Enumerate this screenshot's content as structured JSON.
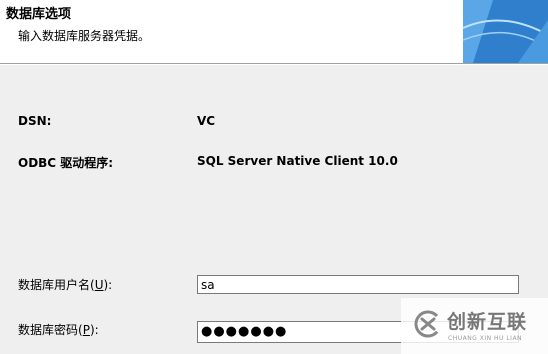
{
  "header": {
    "title": "数据库选项",
    "subtitle": "输入数据库服务器凭据。"
  },
  "details": {
    "dsn_label": "DSN:",
    "dsn_value": "VC",
    "driver_label": "ODBC 驱动程序:",
    "driver_value": "SQL Server Native Client 10.0"
  },
  "credentials": {
    "username_label_pre": "数据库用户名(",
    "username_hotkey": "U",
    "username_label_post": "):",
    "username_value": "sa",
    "password_label_pre": "数据库密码(",
    "password_hotkey": "P",
    "password_label_post": "):",
    "password_value": "●●●●●●●"
  },
  "watermark": {
    "text": "创新互联",
    "sub": "CHUANG XIN HU LIAN"
  },
  "colors": {
    "banner_blue": "#3b8fd8",
    "banner_light": "#9fd0f5"
  }
}
